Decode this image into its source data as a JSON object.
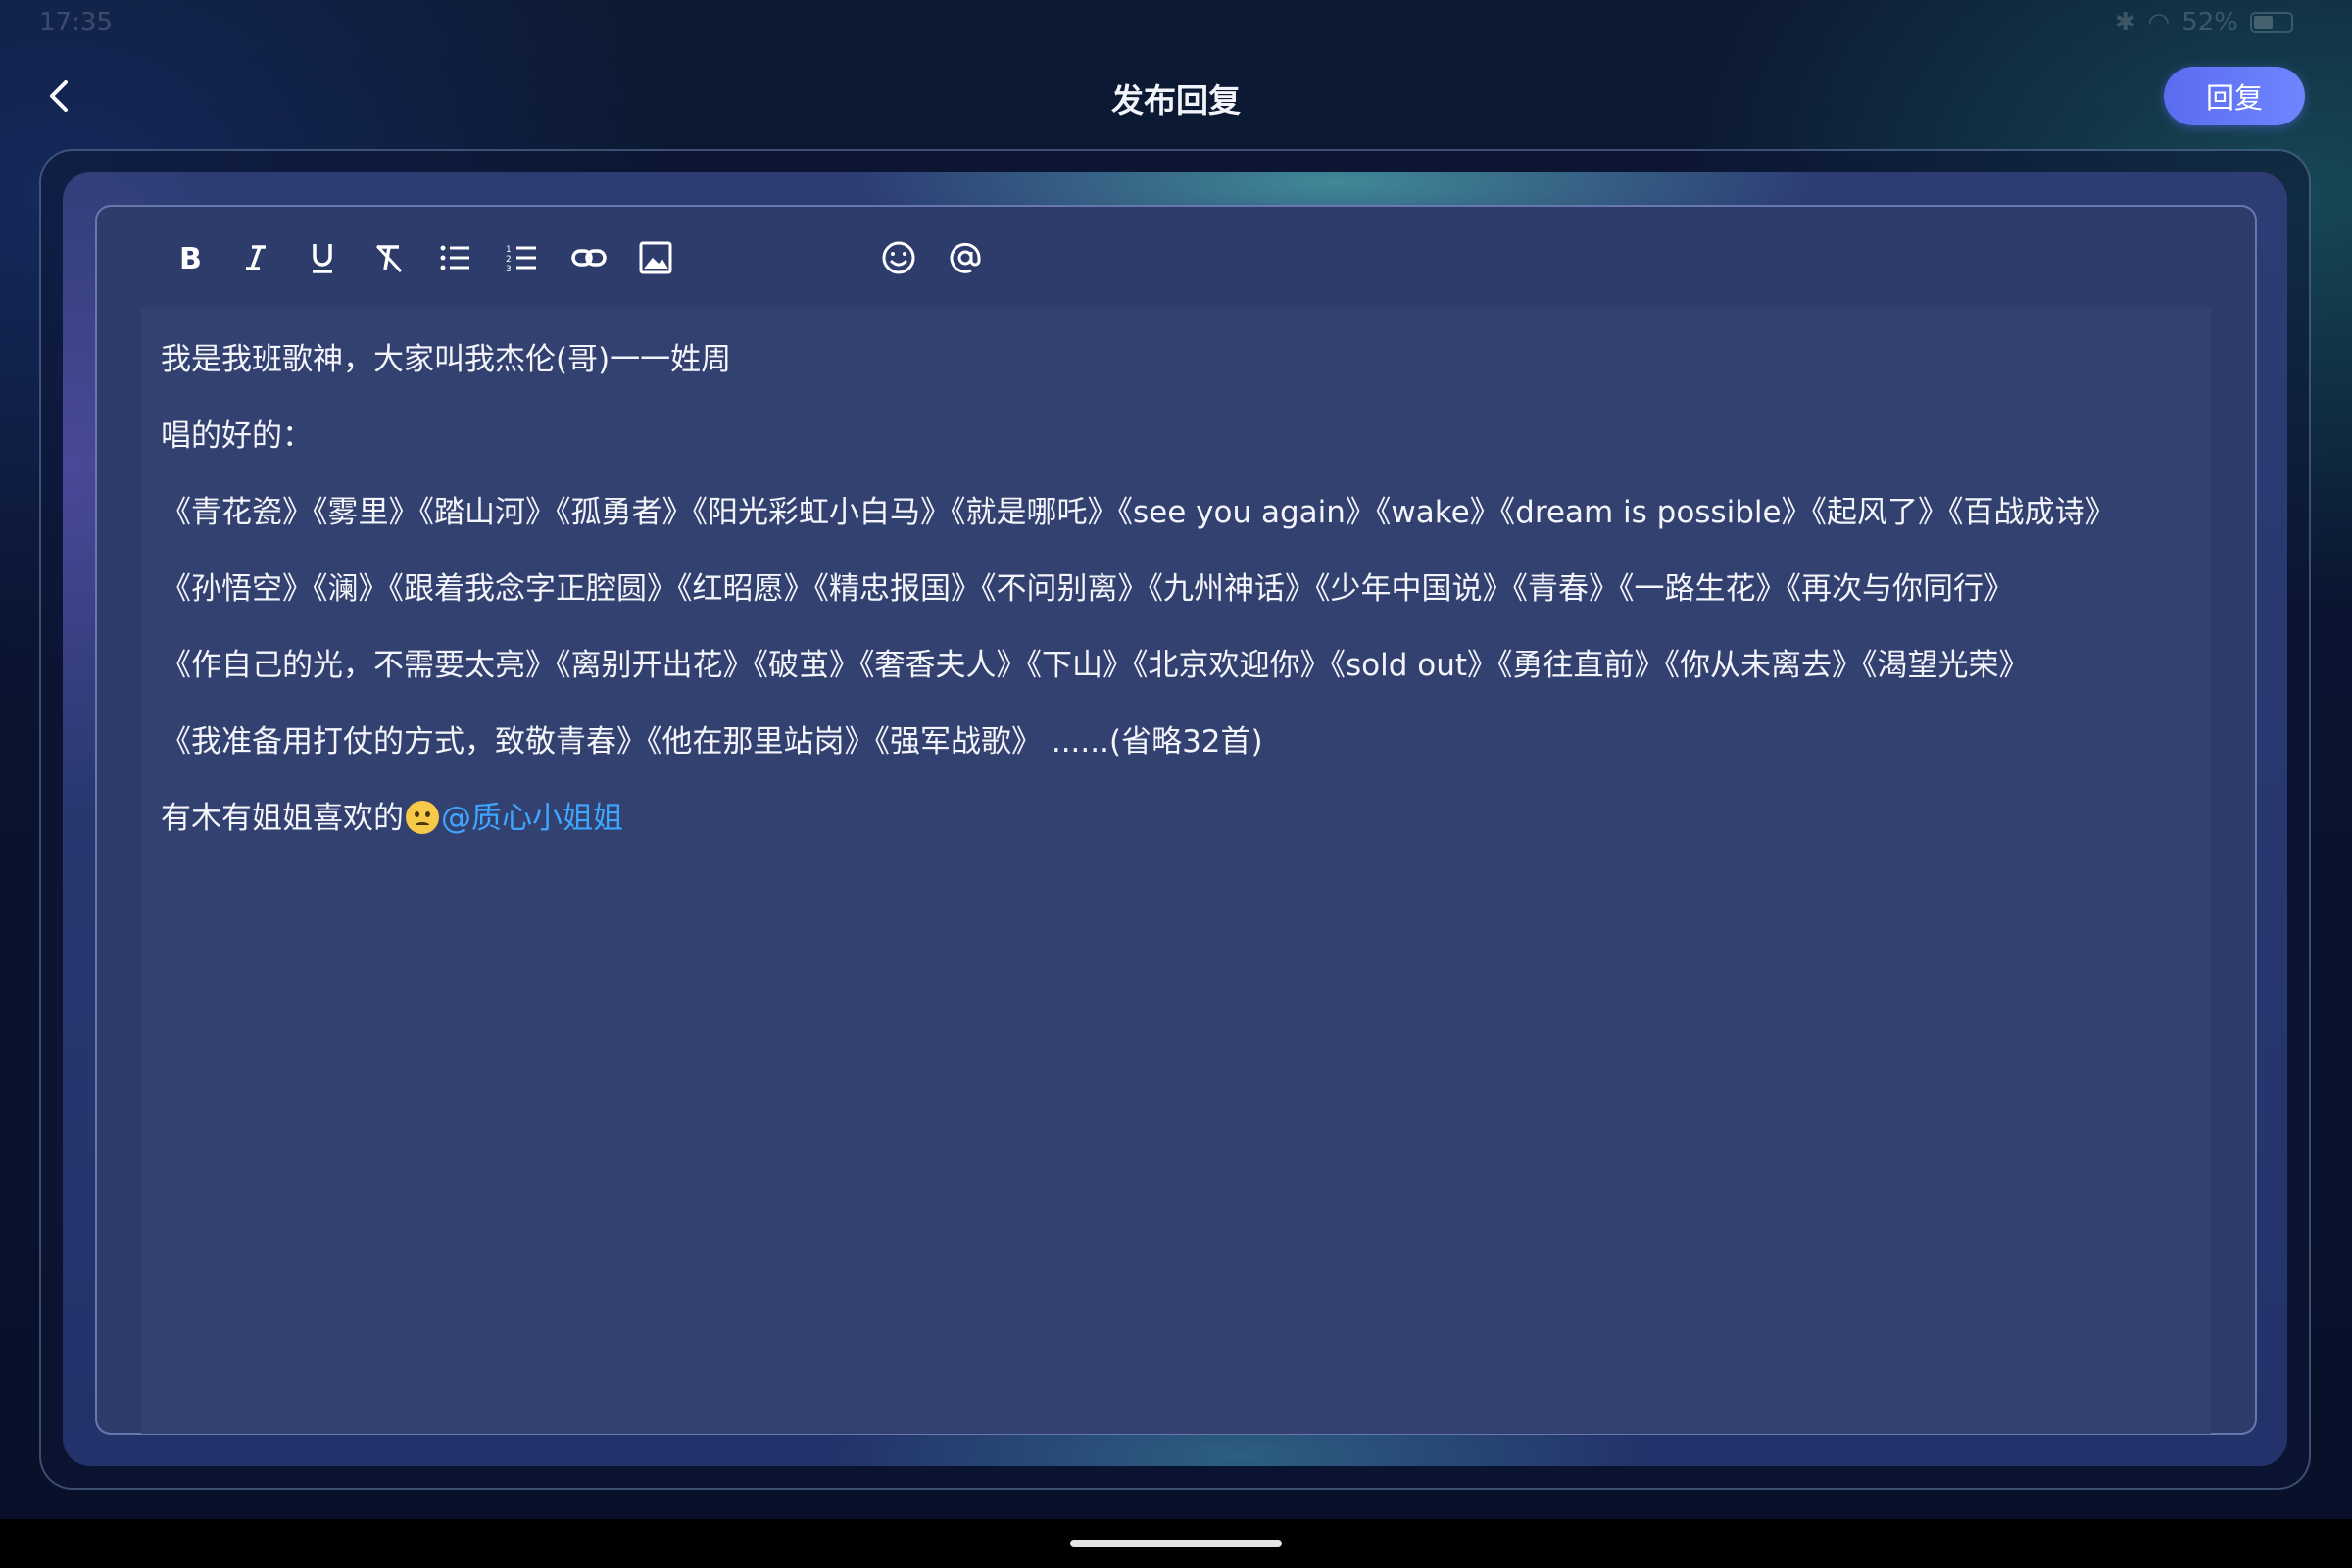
{
  "status_bar": {
    "time": "17:35",
    "battery_text": "52%",
    "battery_level": 0.52
  },
  "header": {
    "title": "发布回复",
    "reply_label": "回复"
  },
  "toolbar": {
    "tools": [
      "bold-icon",
      "italic-icon",
      "underline-icon",
      "clear-format-icon",
      "bulleted-list-icon",
      "numbered-list-icon",
      "link-icon",
      "image-icon",
      "emoji-icon",
      "mention-icon"
    ]
  },
  "editor": {
    "lines": [
      "我是我班歌神，大家叫我杰伦(哥)一一姓周",
      "唱的好的：",
      "《青花瓷》《雾里》《踏山河》《孤勇者》《阳光彩虹小白马》《就是哪吒》《see you again》《wake》《dream is possible》《起风了》《百战成诗》",
      "《孙悟空》《澜》《跟着我念字正腔圆》《红昭愿》《精忠报国》《不问别离》《九州神话》《少年中国说》《青春》《一路生花》《再次与你同行》",
      "《作自己的光，不需要太亮》《离别开出花》《破茧》《奢香夫人》《下山》《北京欢迎你》《sold out》《勇往直前》《你从未离去》《渴望光荣》",
      "《我准备用打仗的方式，致敬青春》《他在那里站岗》《强军战歌》 ......(省略32首)"
    ],
    "last_line_text": "有木有姐姐喜欢的",
    "last_line_emoji": "sad-face-emoji",
    "mention": "@质心小姐姐"
  },
  "colors": {
    "accent": "#5a6cf0",
    "mention": "#3fa6ff",
    "editor_bg": "#334170"
  }
}
